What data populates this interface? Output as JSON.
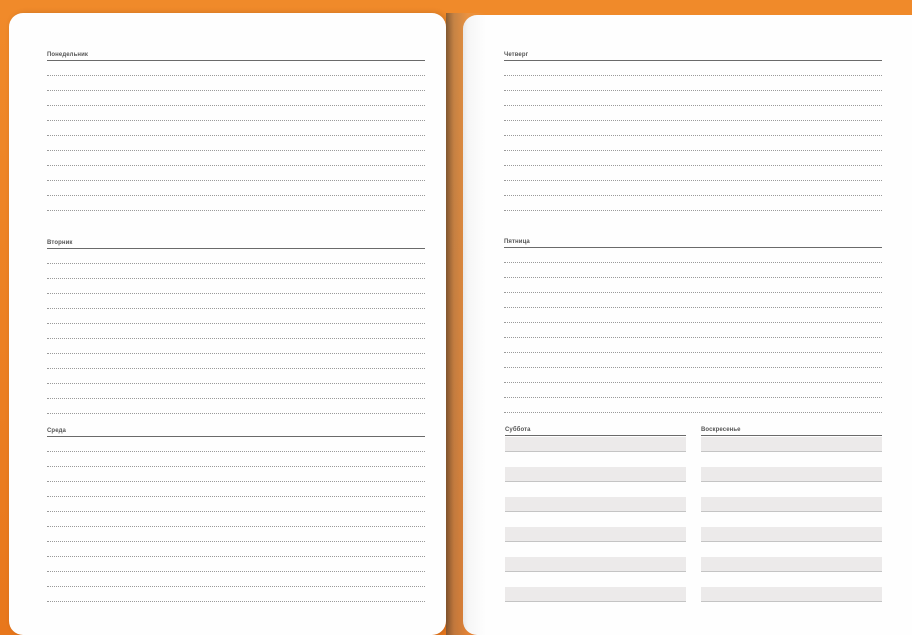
{
  "planner": {
    "left_page": {
      "days": [
        {
          "title": "Понедельник"
        },
        {
          "title": "Вторник"
        },
        {
          "title": "Среда"
        }
      ]
    },
    "right_page": {
      "days": [
        {
          "title": "Четверг"
        },
        {
          "title": "Пятница"
        }
      ],
      "weekend": [
        {
          "title": "Суббота"
        },
        {
          "title": "Воскресенье"
        }
      ]
    }
  },
  "colors": {
    "background": "#ea7a1f",
    "page": "#fefefe",
    "weekend_shade": "#eceaea"
  }
}
